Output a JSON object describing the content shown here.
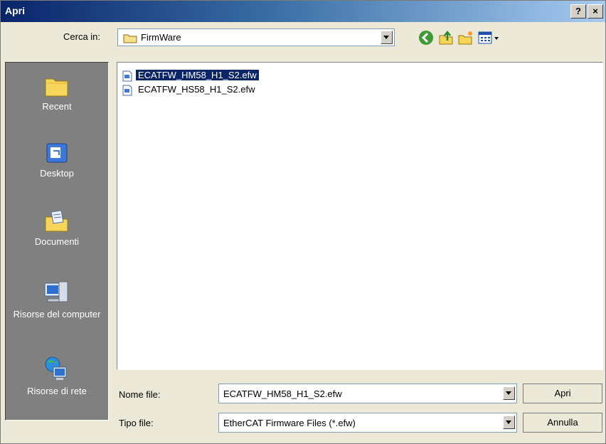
{
  "window": {
    "title": "Apri",
    "help_label": "?",
    "close_label": "×"
  },
  "lookin": {
    "label": "Cerca in:",
    "value": "FirmWare"
  },
  "toolbar": {
    "icons": [
      "back-icon",
      "up-folder-icon",
      "new-folder-icon",
      "view-menu-icon"
    ]
  },
  "places": [
    {
      "label": "Recent",
      "icon": "recent-folder-icon"
    },
    {
      "label": "Desktop",
      "icon": "desktop-icon"
    },
    {
      "label": "Documenti",
      "icon": "documents-icon"
    },
    {
      "label": "Risorse del computer",
      "icon": "my-computer-icon"
    },
    {
      "label": "Risorse di rete",
      "icon": "network-icon"
    }
  ],
  "files": [
    {
      "name": "ECATFW_HM58_H1_S2.efw",
      "selected": true
    },
    {
      "name": "ECATFW_HS58_H1_S2.efw",
      "selected": false
    }
  ],
  "filename": {
    "label": "Nome file:",
    "value": "ECATFW_HM58_H1_S2.efw"
  },
  "filetype": {
    "label": "Tipo file:",
    "value": "EtherCAT Firmware Files (*.efw)"
  },
  "buttons": {
    "open": "Apri",
    "cancel": "Annulla"
  },
  "colors": {
    "selection": "#0a246a",
    "places_bg": "#808080",
    "dialog_bg": "#ece9d8"
  }
}
